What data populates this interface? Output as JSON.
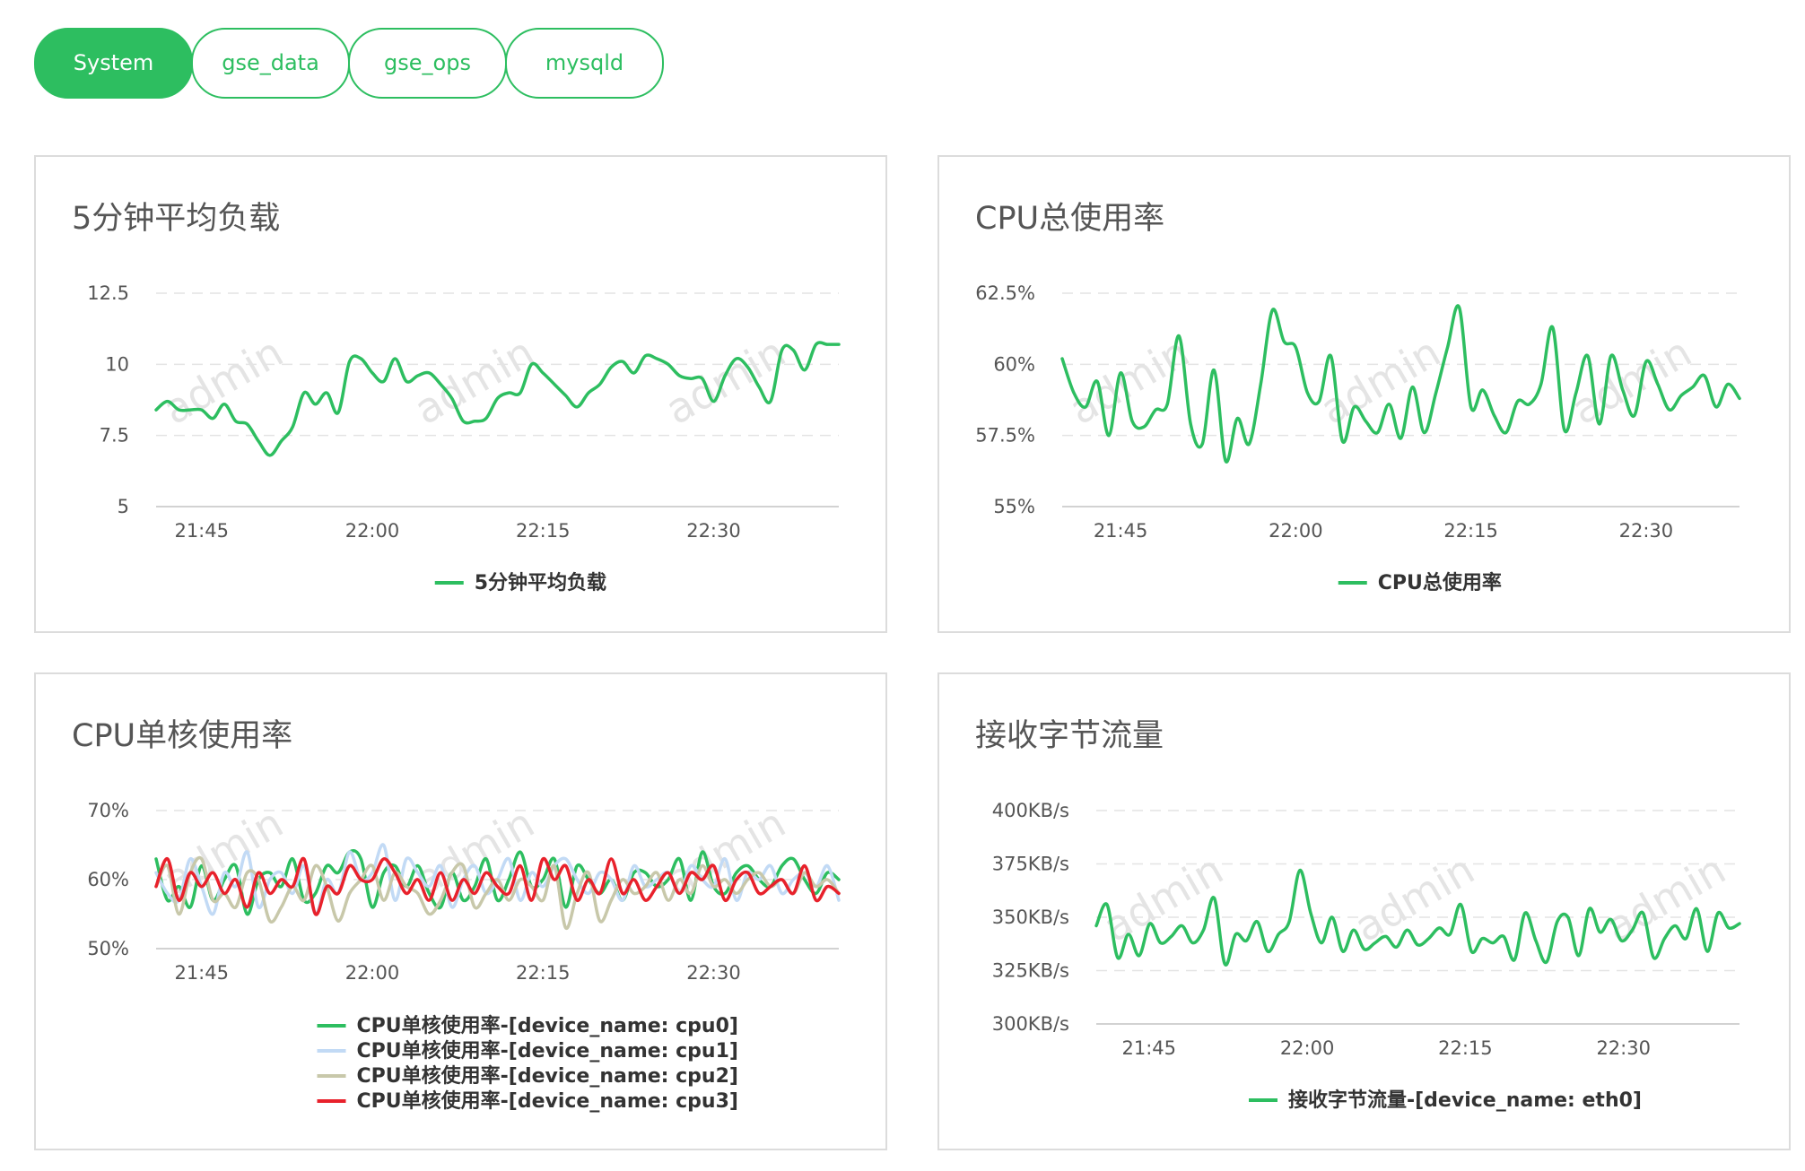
{
  "tabs": [
    {
      "label": "System",
      "active": true
    },
    {
      "label": "gse_data",
      "active": false
    },
    {
      "label": "gse_ops",
      "active": false
    },
    {
      "label": "mysqld",
      "active": false
    }
  ],
  "colors": {
    "accent": "#2dbe60",
    "series": [
      "#2dbe60",
      "#c2daf5",
      "#c8c8aa",
      "#e8212b"
    ],
    "border": "#dcdcdc"
  },
  "watermark": "admin",
  "panels": [
    {
      "title": "5分钟平均负载"
    },
    {
      "title": "CPU总使用率"
    },
    {
      "title": "CPU单核使用率"
    },
    {
      "title": "接收字节流量"
    }
  ],
  "chart_data": [
    {
      "type": "line",
      "title": "5分钟平均负载",
      "ylim": [
        5,
        12.5
      ],
      "yticks": [
        5,
        7.5,
        10,
        12.5
      ],
      "ytick_labels": [
        "5",
        "7.5",
        "10",
        "12.5"
      ],
      "x_start": "21:41",
      "x_end": "22:41",
      "xticks": [
        "21:45",
        "22:00",
        "22:15",
        "22:30"
      ],
      "legend": "bottom",
      "grid": true,
      "series": [
        {
          "name": "5分钟平均负载",
          "x": [
            "21:41",
            "21:42",
            "21:43",
            "21:44",
            "21:45",
            "21:46",
            "21:47",
            "21:48",
            "21:49",
            "21:50",
            "21:51",
            "21:52",
            "21:53",
            "21:54",
            "21:55",
            "21:56",
            "21:57",
            "21:58",
            "21:59",
            "22:00",
            "22:01",
            "22:02",
            "22:03",
            "22:04",
            "22:05",
            "22:06",
            "22:07",
            "22:08",
            "22:09",
            "22:10",
            "22:11",
            "22:12",
            "22:13",
            "22:14",
            "22:15",
            "22:16",
            "22:17",
            "22:18",
            "22:19",
            "22:20",
            "22:21",
            "22:22",
            "22:23",
            "22:24",
            "22:25",
            "22:26",
            "22:27",
            "22:28",
            "22:29",
            "22:30",
            "22:31",
            "22:32",
            "22:33",
            "22:34",
            "22:35",
            "22:36",
            "22:37",
            "22:38",
            "22:39",
            "22:40",
            "22:41"
          ],
          "values": [
            8.4,
            8.7,
            8.4,
            8.4,
            8.4,
            8.1,
            8.6,
            8.0,
            7.9,
            7.3,
            6.8,
            7.3,
            7.8,
            9.0,
            8.6,
            9.0,
            8.3,
            10.1,
            10.2,
            9.7,
            9.4,
            10.2,
            9.4,
            9.6,
            9.7,
            9.3,
            8.8,
            8.0,
            8.0,
            8.1,
            8.8,
            9.0,
            9.0,
            10.0,
            9.7,
            9.3,
            8.9,
            8.5,
            9.0,
            9.3,
            9.9,
            10.1,
            9.7,
            10.3,
            10.2,
            10.0,
            9.6,
            9.5,
            9.5,
            8.7,
            9.6,
            10.2,
            9.9,
            9.2,
            8.7,
            10.5,
            10.5,
            9.8,
            10.7,
            10.7,
            10.7
          ]
        }
      ]
    },
    {
      "type": "line",
      "title": "CPU总使用率",
      "ylim": [
        55,
        62.5
      ],
      "yticks": [
        55,
        57.5,
        60,
        62.5
      ],
      "ytick_labels": [
        "55%",
        "57.5%",
        "60%",
        "62.5%"
      ],
      "x_start": "21:40",
      "x_end": "22:38",
      "xticks": [
        "21:45",
        "22:00",
        "22:15",
        "22:30"
      ],
      "legend": "bottom",
      "grid": true,
      "series": [
        {
          "name": "CPU总使用率",
          "x": [
            "21:40",
            "21:41",
            "21:42",
            "21:43",
            "21:44",
            "21:45",
            "21:46",
            "21:47",
            "21:48",
            "21:49",
            "21:50",
            "21:51",
            "21:52",
            "21:53",
            "21:54",
            "21:55",
            "21:56",
            "21:57",
            "21:58",
            "21:59",
            "22:00",
            "22:01",
            "22:02",
            "22:03",
            "22:04",
            "22:05",
            "22:06",
            "22:07",
            "22:08",
            "22:09",
            "22:10",
            "22:11",
            "22:12",
            "22:13",
            "22:14",
            "22:15",
            "22:16",
            "22:17",
            "22:18",
            "22:19",
            "22:20",
            "22:21",
            "22:22",
            "22:23",
            "22:24",
            "22:25",
            "22:26",
            "22:27",
            "22:28",
            "22:29",
            "22:30",
            "22:31",
            "22:32",
            "22:33",
            "22:34",
            "22:35",
            "22:36",
            "22:37",
            "22:38"
          ],
          "values": [
            60.2,
            59.0,
            58.5,
            59.4,
            57.5,
            59.7,
            58.0,
            57.8,
            58.4,
            58.6,
            61.0,
            57.9,
            57.2,
            59.8,
            56.6,
            58.1,
            57.2,
            59.3,
            61.9,
            60.8,
            60.6,
            59.0,
            58.7,
            60.3,
            57.3,
            58.5,
            58.0,
            57.6,
            58.6,
            57.4,
            59.2,
            57.6,
            59.0,
            60.6,
            62.0,
            58.5,
            59.1,
            58.2,
            57.6,
            58.7,
            58.6,
            59.3,
            61.3,
            57.7,
            59.0,
            60.3,
            57.9,
            60.3,
            59.1,
            58.2,
            60.1,
            59.3,
            58.4,
            58.9,
            59.2,
            59.6,
            58.5,
            59.3,
            58.8
          ]
        }
      ]
    },
    {
      "type": "line",
      "title": "CPU单核使用率",
      "ylim": [
        50,
        70
      ],
      "yticks": [
        50,
        60,
        70
      ],
      "ytick_labels": [
        "50%",
        "60%",
        "70%"
      ],
      "x_start": "21:41",
      "x_end": "22:41",
      "xticks": [
        "21:45",
        "22:00",
        "22:15",
        "22:30"
      ],
      "legend": "bottom",
      "grid": true,
      "series": [
        {
          "name": "CPU单核使用率-[device_name: cpu0]",
          "values": [
            63,
            57,
            59,
            56,
            62,
            57,
            60,
            62,
            55,
            60,
            61,
            59,
            63,
            57,
            58,
            62,
            61,
            64,
            63,
            56,
            61,
            62,
            59,
            62,
            58,
            56,
            61,
            57,
            59,
            63,
            57,
            60,
            64,
            59,
            60,
            63,
            56,
            62,
            60,
            58,
            60,
            57,
            61,
            61,
            59,
            60,
            63,
            57,
            64,
            59,
            58,
            61,
            62,
            60,
            59,
            62,
            63,
            60,
            58,
            61,
            60
          ]
        },
        {
          "name": "CPU单核使用率-[device_name: cpu1]",
          "values": [
            61,
            58,
            57,
            63,
            59,
            55,
            61,
            59,
            64,
            56,
            60,
            61,
            58,
            62,
            55,
            60,
            58,
            64,
            60,
            61,
            65,
            57,
            63,
            61,
            59,
            62,
            56,
            60,
            62,
            58,
            60,
            63,
            57,
            61,
            59,
            62,
            63,
            60,
            58,
            61,
            60,
            57,
            62,
            59,
            60,
            61,
            58,
            62,
            60,
            59,
            63,
            57,
            61,
            60,
            62,
            58,
            60,
            61,
            59,
            62,
            57
          ]
        },
        {
          "name": "CPU单核使用率-[device_name: cpu2]",
          "values": [
            59,
            62,
            55,
            61,
            63,
            57,
            58,
            56,
            61,
            60,
            54,
            56,
            59,
            57,
            62,
            59,
            54,
            58,
            60,
            62,
            57,
            61,
            59,
            58,
            55,
            57,
            61,
            62,
            56,
            58,
            60,
            57,
            60,
            59,
            57,
            62,
            53,
            58,
            61,
            54,
            57,
            60,
            58,
            59,
            61,
            57,
            60,
            58,
            62,
            59,
            60,
            58,
            60,
            61,
            59,
            60,
            58,
            61,
            59,
            60,
            58
          ]
        },
        {
          "name": "CPU单核使用率-[device_name: cpu3]",
          "values": [
            59,
            63,
            57,
            61,
            59,
            61,
            58,
            60,
            56,
            61,
            58,
            60,
            59,
            63,
            55,
            59,
            58,
            62,
            60,
            60,
            63,
            61,
            58,
            60,
            57,
            61,
            57,
            60,
            58,
            61,
            59,
            58,
            62,
            57,
            63,
            60,
            62,
            57,
            60,
            58,
            63,
            58,
            60,
            57,
            59,
            61,
            58,
            61,
            60,
            62,
            57,
            60,
            61,
            58,
            59,
            60,
            58,
            62,
            57,
            59,
            58
          ]
        }
      ]
    },
    {
      "type": "line",
      "title": "接收字节流量",
      "ylim": [
        300,
        400
      ],
      "yticks": [
        300,
        325,
        350,
        375,
        400
      ],
      "ytick_labels": [
        "300KB/s",
        "325KB/s",
        "350KB/s",
        "375KB/s",
        "400KB/s"
      ],
      "x_start": "21:40",
      "x_end": "22:41",
      "xticks": [
        "21:45",
        "22:00",
        "22:15",
        "22:30"
      ],
      "legend": "bottom",
      "grid": true,
      "series": [
        {
          "name": "接收字节流量-[device_name: eth0]",
          "values": [
            346,
            356,
            331,
            342,
            332,
            347,
            338,
            341,
            346,
            338,
            344,
            359,
            328,
            342,
            339,
            348,
            334,
            342,
            348,
            372,
            352,
            338,
            350,
            334,
            344,
            335,
            338,
            341,
            336,
            344,
            337,
            340,
            345,
            342,
            356,
            334,
            340,
            338,
            341,
            330,
            352,
            339,
            329,
            348,
            350,
            332,
            354,
            343,
            349,
            339,
            344,
            352,
            331,
            340,
            346,
            340,
            354,
            334,
            352,
            345,
            347
          ]
        }
      ]
    }
  ]
}
